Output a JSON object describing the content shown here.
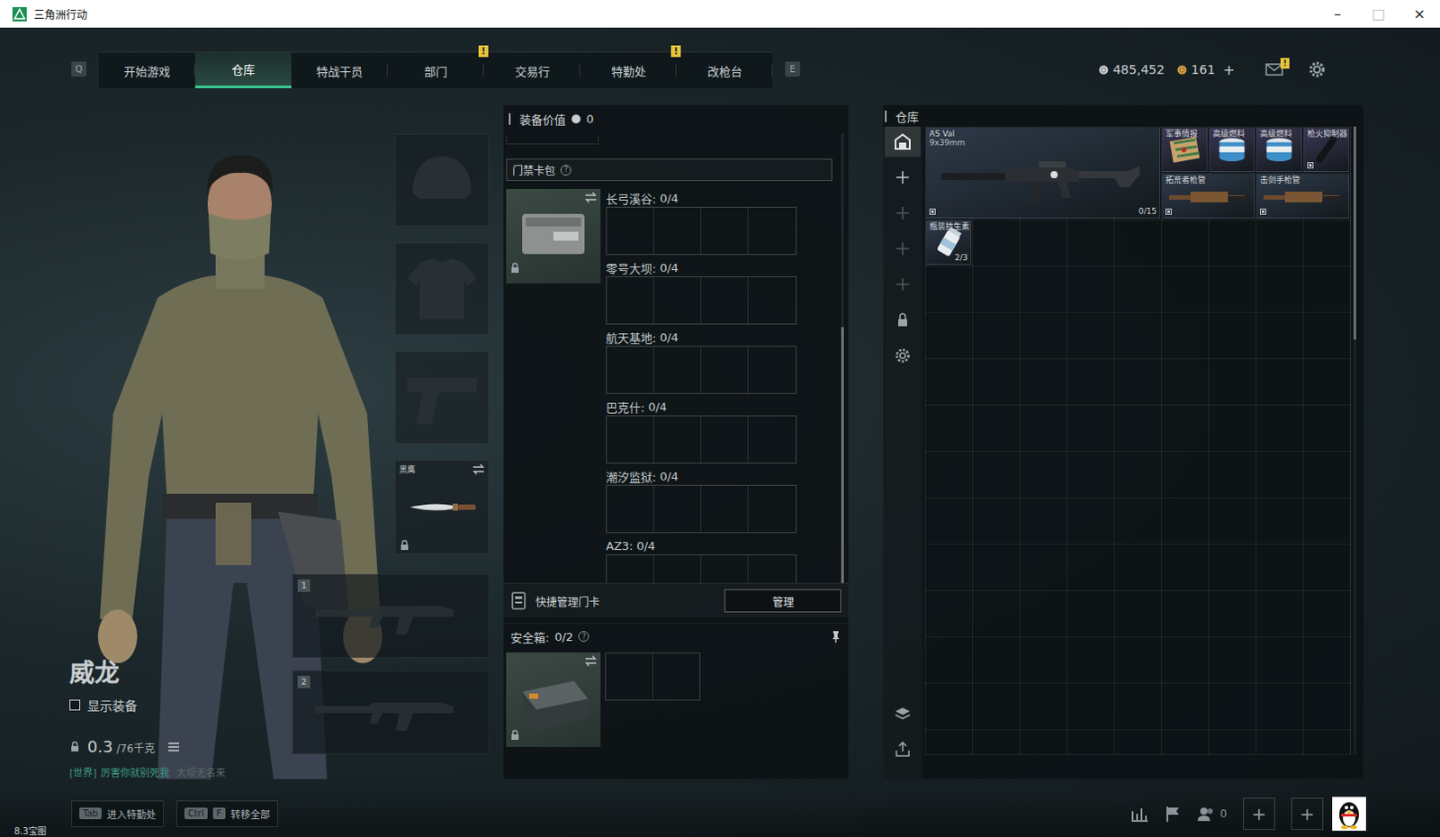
{
  "window": {
    "title": "三角洲行动",
    "controls": [
      {
        "glyph": "–",
        "disabled": false
      },
      {
        "glyph": "□",
        "disabled": true
      },
      {
        "glyph": "×",
        "disabled": false
      }
    ]
  },
  "nav": {
    "key_prev": "Q",
    "key_next": "E",
    "tabs": [
      {
        "label": "开始游戏",
        "selected": false
      },
      {
        "label": "仓库",
        "selected": true
      },
      {
        "label": "特战干员",
        "selected": false
      },
      {
        "label": "部门",
        "selected": false,
        "badge": "!"
      },
      {
        "label": "交易行",
        "selected": false
      },
      {
        "label": "特勤处",
        "selected": false,
        "badge": "!"
      },
      {
        "label": "改枪台",
        "selected": false
      }
    ],
    "currencies": [
      {
        "kind": "silver",
        "amount": "485,452"
      },
      {
        "kind": "gold",
        "amount": "161",
        "add": "+"
      }
    ],
    "mail": {
      "badge": "!"
    }
  },
  "character": {
    "name": "威龙",
    "show_equipment": {
      "label": "显示装备",
      "checked": false
    },
    "weight": {
      "current": "0.3",
      "max": "/76千克"
    },
    "chat": {
      "channel": "[世界]",
      "message": "厉害你就别死我",
      "sender": "大坝无名来"
    }
  },
  "equipment": {
    "slots": [
      {
        "kind": "helmet"
      },
      {
        "kind": "armor"
      },
      {
        "kind": "pistol"
      },
      {
        "kind": "melee",
        "label": "黑鹰",
        "locked": true
      }
    ],
    "weapons": [
      {
        "number": "1"
      },
      {
        "number": "2"
      }
    ]
  },
  "loadout": {
    "value_label": "装备价值",
    "value": "0",
    "card_pack": {
      "title": "门禁卡包",
      "help": "?",
      "locked": true,
      "maps": [
        {
          "name": "长弓溪谷:",
          "count": "0/4"
        },
        {
          "name": "零号大坝:",
          "count": "0/4"
        },
        {
          "name": "航天基地:",
          "count": "0/4"
        },
        {
          "name": "巴克什:",
          "count": "0/4"
        },
        {
          "name": "潮汐监狱:",
          "count": "0/4"
        },
        {
          "name": "AZ3:",
          "count": "0/4"
        }
      ],
      "scrollbar": {
        "level": 0.57,
        "offset": 0.43
      }
    },
    "quick_manage": {
      "label": "快捷管理门卡",
      "button": "管理"
    },
    "safe_box": {
      "label": "安全箱:",
      "count": "0/2",
      "help": "?",
      "locked": true
    }
  },
  "warehouse": {
    "title": "仓库",
    "sidebar": [
      {
        "kind": "warehouse",
        "selected": true,
        "disabled": false
      },
      {
        "kind": "add",
        "selected": false,
        "disabled": false
      },
      {
        "kind": "add",
        "selected": false,
        "disabled": true
      },
      {
        "kind": "add",
        "selected": false,
        "disabled": true
      },
      {
        "kind": "add",
        "selected": false,
        "disabled": true
      },
      {
        "kind": "lock",
        "selected": false,
        "disabled": false
      },
      {
        "kind": "settings",
        "selected": false,
        "disabled": false
      }
    ],
    "sidebar_bottom": [
      {
        "kind": "layers"
      },
      {
        "kind": "transfer"
      }
    ],
    "items": [
      {
        "kind": "rifle",
        "name": "AS Val",
        "sub": "9x39mm",
        "count": "0/15",
        "color": "#2e3a4a"
      },
      {
        "kind": "intel",
        "name": "军事情报",
        "color": "#3b3654"
      },
      {
        "kind": "fuel",
        "name": "高级燃料",
        "color": "#3b3654"
      },
      {
        "kind": "fuel",
        "name": "高级燃料",
        "color": "#3b3654"
      },
      {
        "kind": "suppressor",
        "name": "枪火抑制器",
        "color": "#3b3654"
      },
      {
        "kind": "barrel",
        "name": "拓荒者枪管",
        "color": "#2e3a4a"
      },
      {
        "kind": "barrel",
        "name": "击剑手枪管",
        "color": "#2e3a4a"
      },
      {
        "kind": "medicine",
        "name": "瓶装抗生素",
        "count": "2/3",
        "color": "#2e3a4a"
      }
    ],
    "scrollbar": {
      "level": 0.34,
      "offset": 0
    }
  },
  "bottom_bar": {
    "hints": [
      {
        "keys": [
          "Tab"
        ],
        "label": "进入特勤处"
      },
      {
        "keys": [
          "Ctrl",
          "F"
        ],
        "label": "转移全部"
      }
    ],
    "friends": "0",
    "slots": [
      "+",
      "+"
    ],
    "corner": "8.3宝图"
  }
}
